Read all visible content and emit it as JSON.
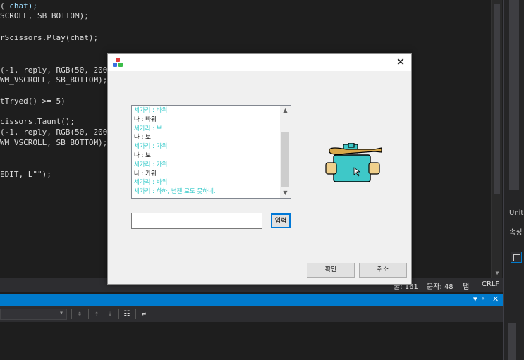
{
  "editor": {
    "lines": [
      {
        "pre": "",
        "fn": "",
        "rest": "chat);",
        "cls": "kw"
      },
      {
        "pre": "",
        "fn": "",
        "rest": "SCROLL, SB_BOTTOM);",
        "cls": ""
      },
      {
        "pre": "",
        "fn": "",
        "rest": "rScissors.Play(chat);",
        "cls": ""
      },
      {
        "pre": "",
        "fn": "",
        "rest": "(-1, reply, RGB(50, 200, 2",
        "cls": ""
      },
      {
        "pre": "",
        "fn": "",
        "rest": "WM_VSCROLL, SB_BOTTOM);",
        "cls": ""
      },
      {
        "pre": "",
        "fn": "",
        "rest": "tTryed() >= 5)",
        "cls": ""
      },
      {
        "pre": "",
        "fn": "",
        "rest": "cissors.Taunt();",
        "cls": ""
      },
      {
        "pre": "",
        "fn": "",
        "rest": "(-1, reply, RGB(50, 200, 2",
        "cls": ""
      },
      {
        "pre": "",
        "fn": "",
        "rest": "WM_VSCROLL, SB_BOTTOM);",
        "cls": ""
      },
      {
        "pre": "",
        "fn": "",
        "rest": "EDIT, L\"\");",
        "cls": ""
      }
    ]
  },
  "status_bar": {
    "line": "줄: 161",
    "chars": "문자: 48",
    "tab": "탭",
    "eol": "CRLF"
  },
  "right_panel": {
    "tab_unit": "Unit",
    "tab_props": "속성"
  },
  "output_header": {
    "dropdown": "▾",
    "pin": "ᵖ",
    "close": "✕"
  },
  "dialog": {
    "close_glyph": "✕",
    "chat_lines": [
      {
        "text": "세가리 : 바위",
        "who": "bot"
      },
      {
        "text": "나 : 바위",
        "who": "me"
      },
      {
        "text": "세가리 : 보",
        "who": "bot"
      },
      {
        "text": "나 : 보",
        "who": "me"
      },
      {
        "text": "세가리 : 가위",
        "who": "bot"
      },
      {
        "text": "나 : 보",
        "who": "me"
      },
      {
        "text": "세가리 : 가위",
        "who": "bot"
      },
      {
        "text": "나 : 가위",
        "who": "me"
      },
      {
        "text": "세가리 : 바위",
        "who": "bot"
      },
      {
        "text": "세가리 : 하하, 넌젠 로도 못하네.",
        "who": "bot"
      }
    ],
    "input_value": "",
    "send_label": "입력",
    "ok_label": "확인",
    "cancel_label": "취소",
    "colors": {
      "bot_text": "#32c8c8",
      "robot_body": "#3ec8c8",
      "bat": "#d8a84a"
    }
  }
}
